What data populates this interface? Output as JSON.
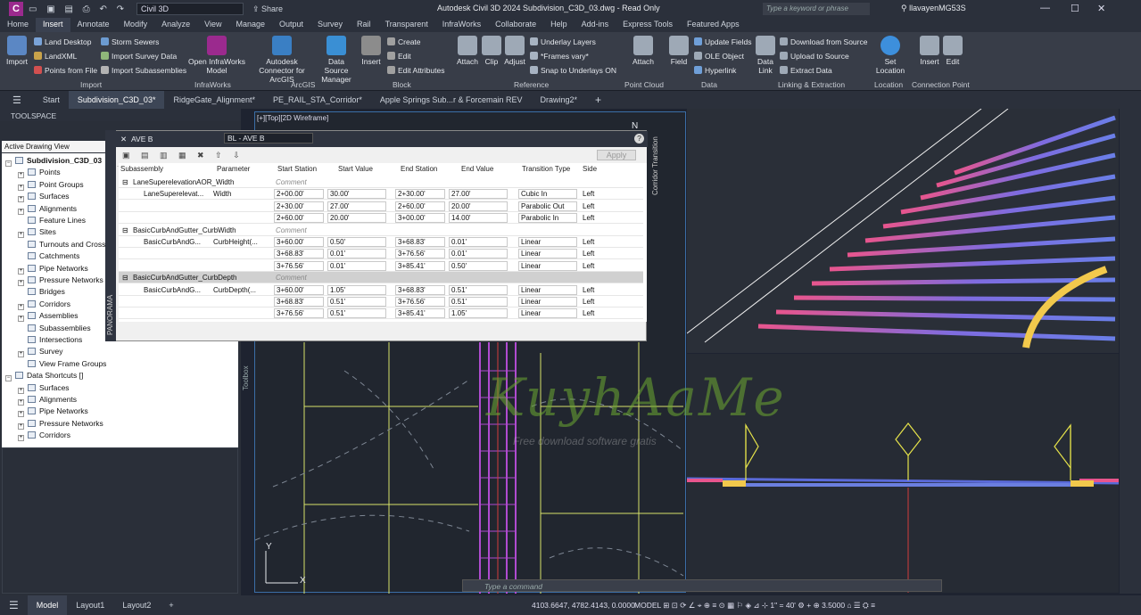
{
  "app": {
    "title": "Autodesk Civil 3D 2024   Subdivision_C3D_03.dwg - Read Only",
    "workspace": "Civil 3D",
    "share": "Share",
    "search_placeholder": "Type a keyword or phrase",
    "user": "llavayenMG53S"
  },
  "ribbon_tabs": [
    "Home",
    "Insert",
    "Annotate",
    "Modify",
    "Analyze",
    "View",
    "Manage",
    "Output",
    "Survey",
    "Rail",
    "Transparent",
    "InfraWorks",
    "Collaborate",
    "Help",
    "Add-ins",
    "Express Tools",
    "Featured Apps"
  ],
  "ribbon": {
    "import": "Import",
    "land_desktop": "Land Desktop",
    "landxml": "LandXML",
    "points_from_file": "Points from File",
    "storm_sewers": "Storm Sewers",
    "import_survey": "Import Survey Data",
    "import_subassemblies": "Import Subassemblies",
    "open_infraworks": "Open InfraWorks Model",
    "autodesk_connector": "Autodesk Connector for ArcGIS",
    "data_source_manager": "Data Source Manager",
    "insert": "Insert",
    "create": "Create",
    "edit": "Edit",
    "edit_attributes": "Edit Attributes",
    "attach": "Attach",
    "clip": "Clip",
    "adjust": "Adjust",
    "underlay_layers": "Underlay Layers",
    "frames_vary": "*Frames vary*",
    "snap_underlays": "Snap to Underlays ON",
    "attach_pc": "Attach",
    "field": "Field",
    "update_fields": "Update Fields",
    "ole_object": "OLE Object",
    "hyperlink": "Hyperlink",
    "data_link": "Data Link",
    "download_source": "Download from Source",
    "upload_source": "Upload to Source",
    "extract_data": "Extract  Data",
    "set_location": "Set Location",
    "insert_cp": "Insert",
    "edit_cp": "Edit",
    "groups": [
      "Import",
      "InfraWorks",
      "ArcGIS",
      "Block",
      "Reference",
      "Point Cloud",
      "Data",
      "Linking & Extraction",
      "Location",
      "Connection Point"
    ]
  },
  "doc_tabs": [
    "Start",
    "Subdivision_C3D_03*",
    "RidgeGate_Alignment*",
    "PE_RAIL_STA_Corridor*",
    "Apple Springs Sub...r & Forcemain REV",
    "Drawing2*"
  ],
  "toolspace": {
    "header": "TOOLSPACE",
    "tab": "Active Drawing View",
    "tree": [
      "Subdivision_C3D_03",
      "Points",
      "Point Groups",
      "Surfaces",
      "Alignments",
      "Feature Lines",
      "Sites",
      "Turnouts and Crossings",
      "Catchments",
      "Pipe Networks",
      "Pressure Networks",
      "Bridges",
      "Corridors",
      "Assemblies",
      "Subassemblies",
      "Intersections",
      "Survey",
      "View Frame Groups",
      "Data Shortcuts []",
      "Surfaces",
      "Alignments",
      "Pipe Networks",
      "Pressure Networks",
      "Corridors"
    ]
  },
  "viewport": {
    "label": "[+][Top][2D Wireframe]",
    "ucs_x": "X",
    "ucs_y": "Y",
    "north": "N"
  },
  "panel": {
    "title": "AVE B",
    "baseline": "BL - AVE B",
    "apply": "Apply",
    "side_tab": "Corridor Transition",
    "panorama": "PANORAMA",
    "columns": [
      "Subassembly",
      "Parameter",
      "Start Station",
      "Start Value",
      "End Station",
      "End Value",
      "Transition Type",
      "Side"
    ],
    "groups": [
      {
        "name": "LaneSuperelevationAOR_Width",
        "comment": "Comment",
        "sub": "LaneSuperelevat...",
        "param": "Width",
        "rows": [
          {
            "ss": "2+00.00'",
            "sv": "30.00'",
            "es": "2+30.00'",
            "ev": "27.00'",
            "tt": "Cubic In",
            "side": "Left"
          },
          {
            "ss": "2+30.00'",
            "sv": "27.00'",
            "es": "2+60.00'",
            "ev": "20.00'",
            "tt": "Parabolic Out",
            "side": "Left"
          },
          {
            "ss": "2+60.00'",
            "sv": "20.00'",
            "es": "3+00.00'",
            "ev": "14.00'",
            "tt": "Parabolic In",
            "side": "Left"
          }
        ]
      },
      {
        "name": "BasicCurbAndGutter_CurbWidth",
        "comment": "Comment",
        "sub": "BasicCurbAndG...",
        "param": "CurbHeight(...",
        "rows": [
          {
            "ss": "3+60.00'",
            "sv": "0.50'",
            "es": "3+68.83'",
            "ev": "0.01'",
            "tt": "Linear",
            "side": "Left"
          },
          {
            "ss": "3+68.83'",
            "sv": "0.01'",
            "es": "3+76.56'",
            "ev": "0.01'",
            "tt": "Linear",
            "side": "Left"
          },
          {
            "ss": "3+76.56'",
            "sv": "0.01'",
            "es": "3+85.41'",
            "ev": "0.50'",
            "tt": "Linear",
            "side": "Left"
          }
        ]
      },
      {
        "name": "BasicCurbAndGutter_CurbDepth",
        "comment": "Comment",
        "sub": "BasicCurbAndG...",
        "param": "CurbDepth(...",
        "rows": [
          {
            "ss": "3+60.00'",
            "sv": "1.05'",
            "es": "3+68.83'",
            "ev": "0.51'",
            "tt": "Linear",
            "side": "Left"
          },
          {
            "ss": "3+68.83'",
            "sv": "0.51'",
            "es": "3+76.56'",
            "ev": "0.51'",
            "tt": "Linear",
            "side": "Left"
          },
          {
            "ss": "3+76.56'",
            "sv": "0.51'",
            "es": "3+85.41'",
            "ev": "1.05'",
            "tt": "Linear",
            "side": "Left"
          }
        ]
      }
    ]
  },
  "toolbox": "Toolbox",
  "command_placeholder": "Type a command",
  "watermark": "KuyhAaMe",
  "watermark_sub": "Free download software gratis",
  "status": {
    "tabs": [
      "Model",
      "Layout1",
      "Layout2"
    ],
    "coords": "4103.6647, 4782.4143, 0.0000",
    "space": "MODEL",
    "scale": "1\" = 40'",
    "value": "3.5000"
  }
}
